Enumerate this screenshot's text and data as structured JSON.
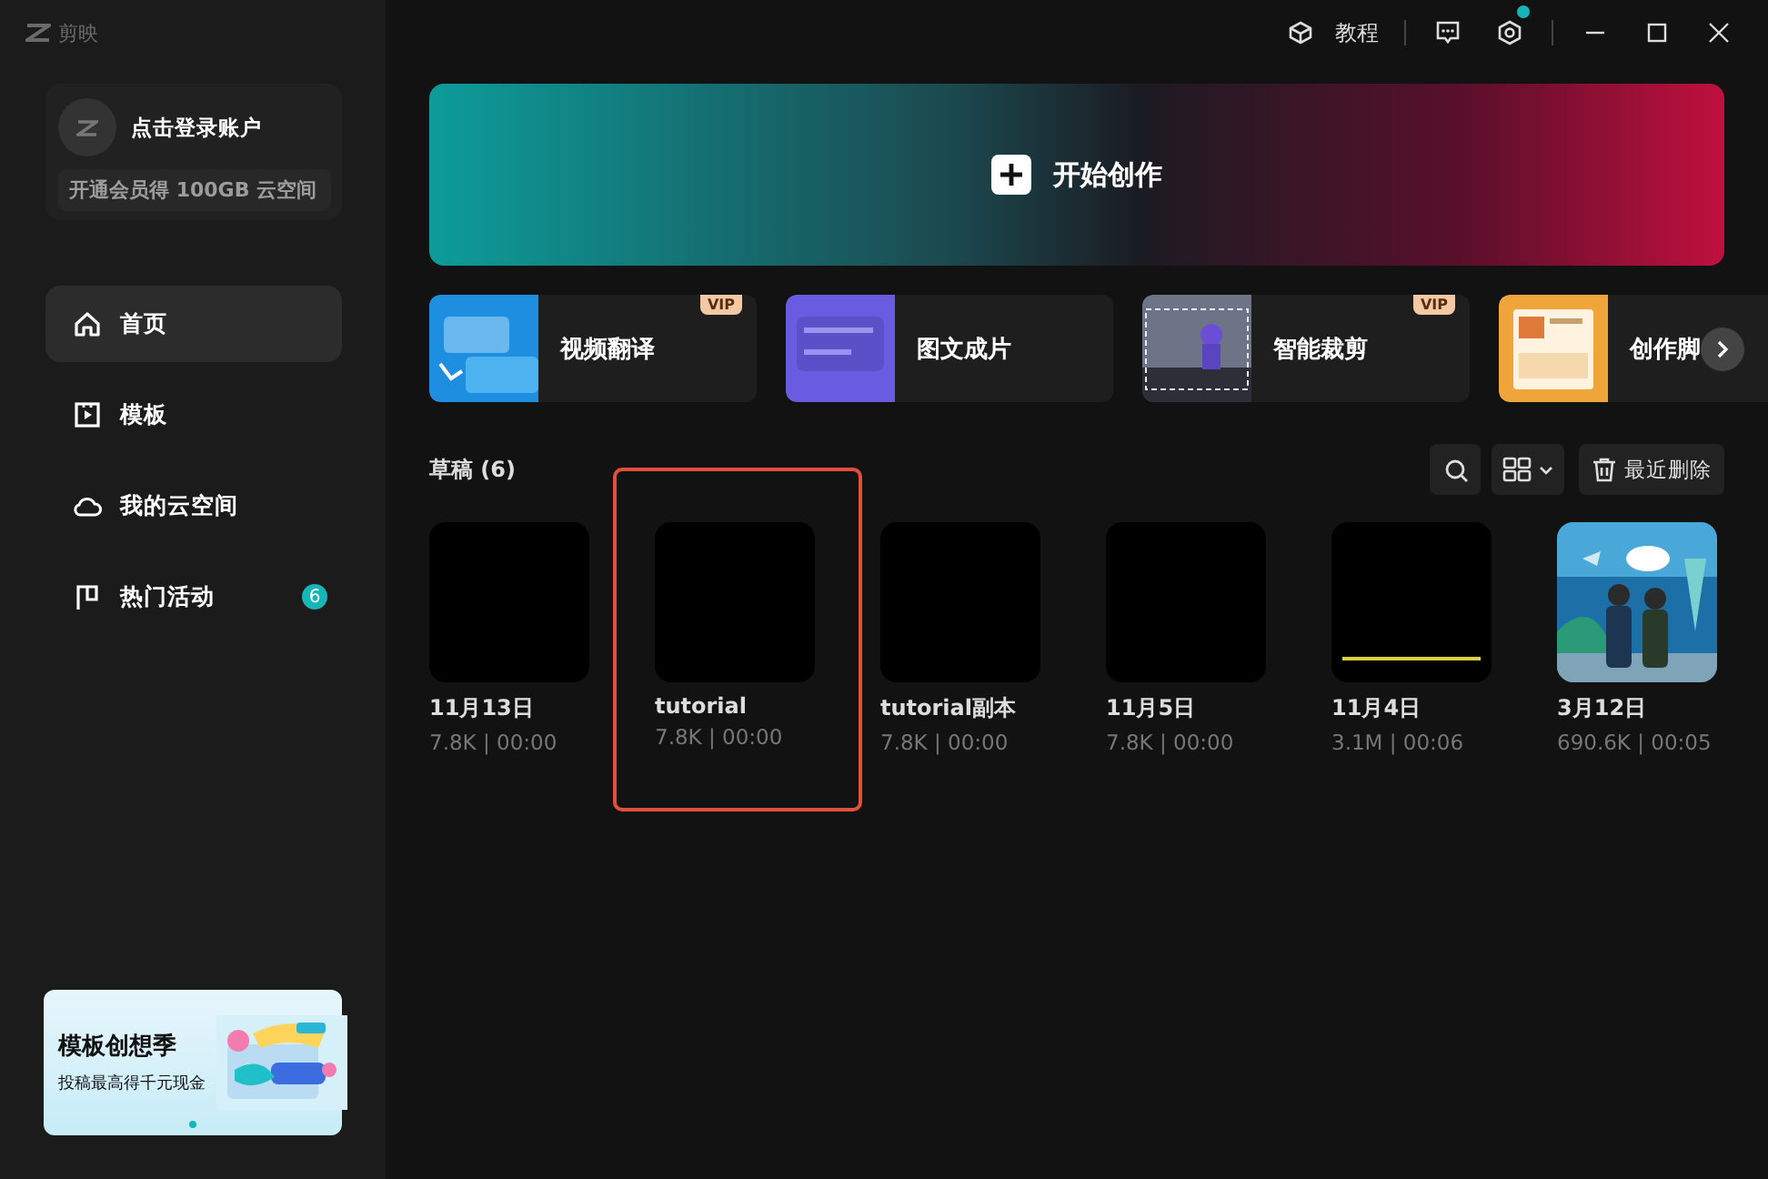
{
  "app": {
    "title": "剪映"
  },
  "toolbar": {
    "tutorial_label": "教程",
    "settings_notification": true
  },
  "account": {
    "login_label": "点击登录账户",
    "promo": "开通会员得 100GB 云空间"
  },
  "nav": [
    {
      "label": "首页",
      "selected": true
    },
    {
      "label": "模板",
      "selected": false
    },
    {
      "label": "我的云空间",
      "selected": false
    },
    {
      "label": "热门活动",
      "selected": false,
      "badge": "6"
    }
  ],
  "banner": {
    "title": "模板创想季",
    "subtitle": "投稿最高得千元现金"
  },
  "create_button": {
    "label": "开始创作"
  },
  "tools": [
    {
      "label": "视频翻译",
      "badge": "VIP"
    },
    {
      "label": "图文成片"
    },
    {
      "label": "智能裁剪",
      "badge": "VIP"
    },
    {
      "label": "创作脚"
    }
  ],
  "drafts": {
    "title": "草稿",
    "count": "(6)",
    "recent_delete": "最近删除",
    "items": [
      {
        "name": "11月13日",
        "meta": "7.8K | 00:00",
        "kind": "blank",
        "highlighted": false
      },
      {
        "name": "tutorial",
        "meta": "7.8K | 00:00",
        "kind": "blank",
        "highlighted": true
      },
      {
        "name": "tutorial副本",
        "meta": "7.8K | 00:00",
        "kind": "blank",
        "highlighted": false
      },
      {
        "name": "11月5日",
        "meta": "7.8K | 00:00",
        "kind": "blank",
        "highlighted": false
      },
      {
        "name": "11月4日",
        "meta": "3.1M | 00:06",
        "kind": "caption",
        "highlighted": false
      },
      {
        "name": "3月12日",
        "meta": "690.6K | 00:05",
        "kind": "picture",
        "highlighted": false
      }
    ]
  }
}
